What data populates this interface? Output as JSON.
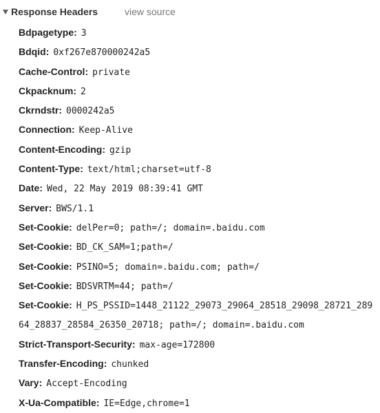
{
  "section": {
    "title": "Response Headers",
    "view_source_label": "view source"
  },
  "headers": [
    {
      "name": "Bdpagetype",
      "value": "3"
    },
    {
      "name": "Bdqid",
      "value": "0xf267e870000242a5"
    },
    {
      "name": "Cache-Control",
      "value": "private"
    },
    {
      "name": "Ckpacknum",
      "value": "2"
    },
    {
      "name": "Ckrndstr",
      "value": "0000242a5"
    },
    {
      "name": "Connection",
      "value": "Keep-Alive"
    },
    {
      "name": "Content-Encoding",
      "value": "gzip"
    },
    {
      "name": "Content-Type",
      "value": "text/html;charset=utf-8"
    },
    {
      "name": "Date",
      "value": "Wed, 22 May 2019 08:39:41 GMT"
    },
    {
      "name": "Server",
      "value": "BWS/1.1"
    },
    {
      "name": "Set-Cookie",
      "value": "delPer=0; path=/; domain=.baidu.com"
    },
    {
      "name": "Set-Cookie",
      "value": "BD_CK_SAM=1;path=/"
    },
    {
      "name": "Set-Cookie",
      "value": "PSINO=5; domain=.baidu.com; path=/"
    },
    {
      "name": "Set-Cookie",
      "value": "BDSVRTM=44; path=/"
    },
    {
      "name": "Set-Cookie",
      "value": "H_PS_PSSID=1448_21122_29073_29064_28518_29098_28721_28964_28837_28584_26350_20718; path=/; domain=.baidu.com"
    },
    {
      "name": "Strict-Transport-Security",
      "value": "max-age=172800"
    },
    {
      "name": "Transfer-Encoding",
      "value": "chunked"
    },
    {
      "name": "Vary",
      "value": "Accept-Encoding"
    },
    {
      "name": "X-Ua-Compatible",
      "value": "IE=Edge,chrome=1"
    }
  ]
}
